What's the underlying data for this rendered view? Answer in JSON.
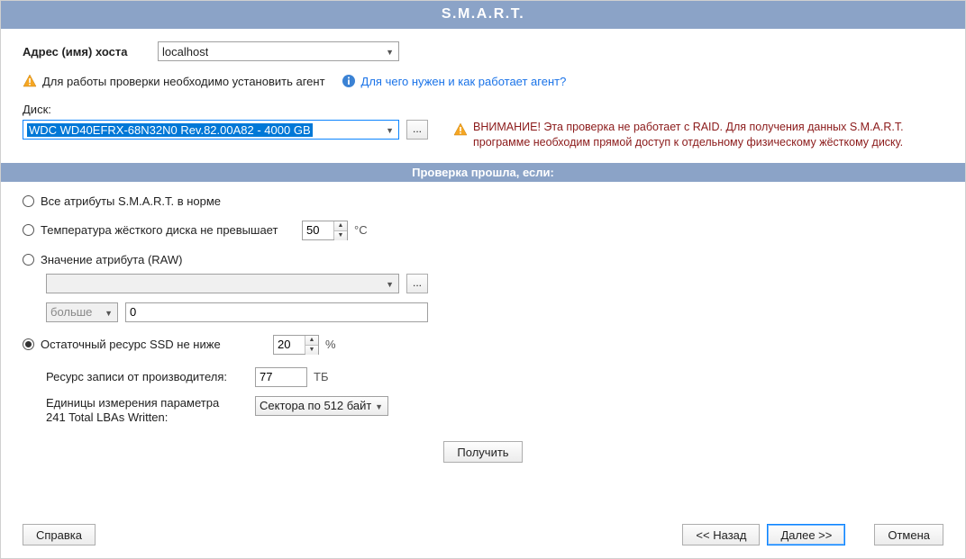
{
  "title": "S.M.A.R.T.",
  "host": {
    "label": "Адрес (имя) хоста",
    "value": "localhost"
  },
  "agent_warning": "Для работы проверки необходимо установить агент",
  "agent_link": "Для чего нужен и как работает агент?",
  "disk": {
    "label": "Диск:",
    "value": "WDC WD40EFRX-68N32N0 Rev.82.00A82 - 4000 GB",
    "browse": "..."
  },
  "raid_warning": "ВНИМАНИЕ! Эта проверка не работает с RAID. Для получения данных S.M.A.R.T. программе необходим прямой доступ к отдельному физическому жёсткому диску.",
  "section_header": "Проверка прошла, если:",
  "opt_all_ok": "Все атрибуты S.M.A.R.T. в норме",
  "opt_temp": {
    "label": "Температура жёсткого диска не превышает",
    "value": "50",
    "unit": "°C"
  },
  "opt_raw": {
    "label": "Значение атрибута (RAW)",
    "attr_value": "",
    "browse": "...",
    "compare": "больше",
    "threshold": "0"
  },
  "opt_ssd": {
    "label": "Остаточный ресурс SSD не ниже",
    "value": "20",
    "unit": "%",
    "vendor_label": "Ресурс записи от производителя:",
    "vendor_value": "77",
    "vendor_unit": "ТБ",
    "units_label1": "Единицы измерения параметра",
    "units_label2": "241 Total  LBAs  Written:",
    "units_value": "Сектора по 512 байт"
  },
  "get_btn": "Получить",
  "footer": {
    "help": "Справка",
    "back": "<< Назад",
    "next": "Далее >>",
    "cancel": "Отмена"
  }
}
